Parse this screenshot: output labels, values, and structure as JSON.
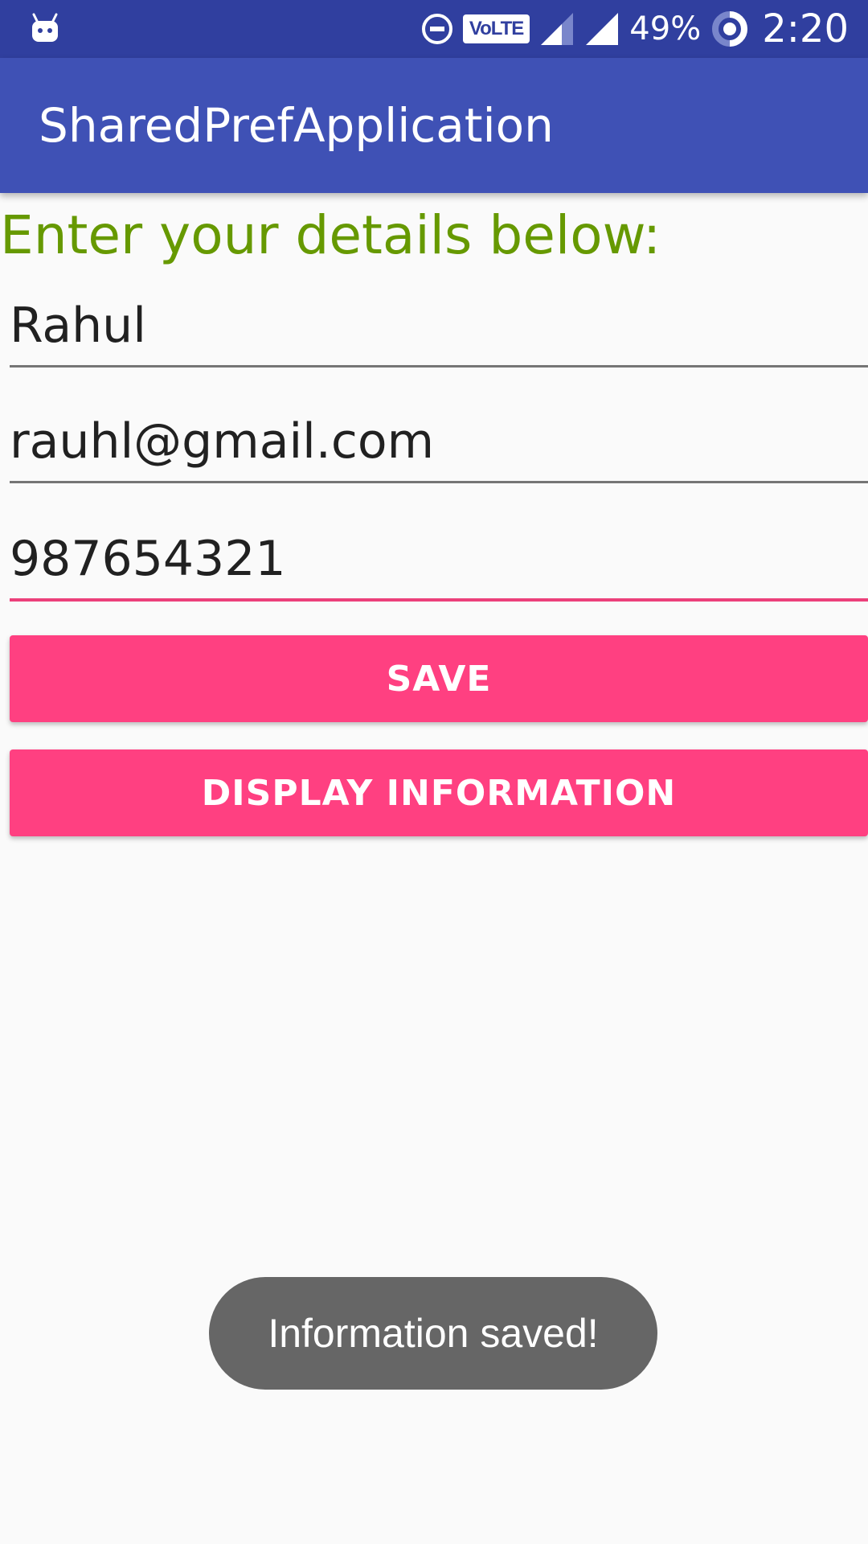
{
  "status_bar": {
    "notification_icon": "android-icon",
    "dnd_icon": "do-not-disturb-icon",
    "volte": "VoLTE",
    "battery": "49%",
    "time": "2:20",
    "colors": {
      "background": "#303f9f"
    }
  },
  "app_bar": {
    "title": "SharedPrefApplication",
    "color": "#3f51b5"
  },
  "form": {
    "heading": "Enter your details below:",
    "name_value": "Rahul",
    "email_value": "rauhl@gmail.com",
    "phone_value": "987654321",
    "save_label": "SAVE",
    "display_label": "DISPLAY INFORMATION",
    "accent_color": "#ff4081",
    "heading_color": "#669900"
  },
  "toast": {
    "message": "Information saved!"
  }
}
